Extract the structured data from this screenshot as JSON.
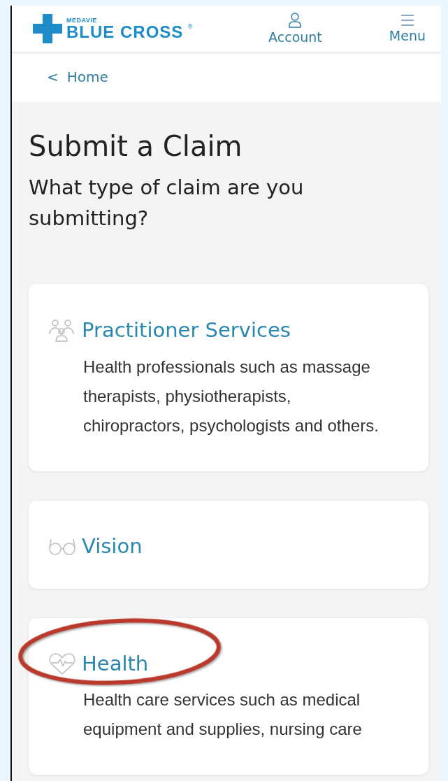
{
  "header": {
    "logo": {
      "small": "MEDAVIE",
      "main": "BLUE CROSS",
      "mark": "®"
    },
    "account": "Account",
    "menu": "Menu"
  },
  "breadcrumb": {
    "arrow": "<",
    "label": "Home"
  },
  "title": "Submit a Claim",
  "question": "What type of claim are you submitting?",
  "cards": [
    {
      "kind": "people",
      "title": "Practitioner Services",
      "description": "Health professionals such as massage therapists, physiotherapists, chiropractors, psychologists and others.",
      "highlighted": false
    },
    {
      "kind": "glasses",
      "title": "Vision",
      "highlighted": false
    },
    {
      "kind": "heart",
      "title": "Health",
      "description": "Health care services such as medical equipment and supplies, nursing care",
      "highlighted": true
    }
  ]
}
